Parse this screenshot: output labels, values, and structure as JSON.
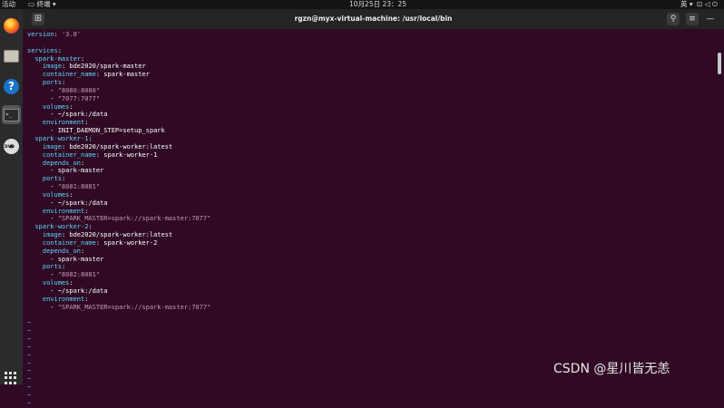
{
  "topbar": {
    "activities": "活动",
    "app": "终端",
    "clock": "10月25日  23：25",
    "lang": "英",
    "system": "▾"
  },
  "window": {
    "title": "rgzn@myx-virtual-machine: /usr/local/bin",
    "new_tab_icon": "new-tab-icon",
    "search_icon": "search-icon",
    "menu_icon": "hamburger-menu-icon",
    "minimize_glyph": "—"
  },
  "dock": {
    "items": [
      "firefox-icon",
      "files-icon",
      "help-icon",
      "terminal-icon",
      "dvd-icon",
      "show-apps-icon"
    ],
    "dvd_label": "DVD",
    "terminal_glyph": ">_"
  },
  "colors": {
    "terminal_bg": "#300a24",
    "key": "#5fd7ff",
    "string": "#c29bb7",
    "tilde": "#5fa8ff"
  },
  "editor": {
    "lines": [
      [
        {
          "t": "version",
          "c": "k"
        },
        {
          "t": ": ",
          "c": "w"
        },
        {
          "t": "'3.8'",
          "c": "s"
        }
      ],
      [],
      [
        {
          "t": "services",
          "c": "k"
        },
        {
          "t": ":",
          "c": "w"
        }
      ],
      [
        {
          "t": "  spark-master",
          "c": "k"
        },
        {
          "t": ":",
          "c": "w"
        }
      ],
      [
        {
          "t": "    image",
          "c": "k"
        },
        {
          "t": ": bde2020/spark-master",
          "c": "w"
        }
      ],
      [
        {
          "t": "    container_name",
          "c": "k"
        },
        {
          "t": ": spark-master",
          "c": "w"
        }
      ],
      [
        {
          "t": "    ports",
          "c": "k"
        },
        {
          "t": ":",
          "c": "w"
        }
      ],
      [
        {
          "t": "      - ",
          "c": "w"
        },
        {
          "t": "\"8080:8080\"",
          "c": "s"
        }
      ],
      [
        {
          "t": "      - ",
          "c": "w"
        },
        {
          "t": "\"7077:7077\"",
          "c": "s"
        }
      ],
      [
        {
          "t": "    volumes",
          "c": "k"
        },
        {
          "t": ":",
          "c": "w"
        }
      ],
      [
        {
          "t": "      - ~/spark:/data",
          "c": "w"
        }
      ],
      [
        {
          "t": "    environment",
          "c": "k"
        },
        {
          "t": ":",
          "c": "w"
        }
      ],
      [
        {
          "t": "      - INIT_DAEMON_STEP=setup_spark",
          "c": "w"
        }
      ],
      [
        {
          "t": "  spark-worker-1",
          "c": "k"
        },
        {
          "t": ":",
          "c": "w"
        }
      ],
      [
        {
          "t": "    image",
          "c": "k"
        },
        {
          "t": ": bde2020/spark-worker:latest",
          "c": "w"
        }
      ],
      [
        {
          "t": "    container_name",
          "c": "k"
        },
        {
          "t": ": spark-worker-1",
          "c": "w"
        }
      ],
      [
        {
          "t": "    depends_on",
          "c": "k"
        },
        {
          "t": ":",
          "c": "w"
        }
      ],
      [
        {
          "t": "      - spark-master",
          "c": "w"
        }
      ],
      [
        {
          "t": "    ports",
          "c": "k"
        },
        {
          "t": ":",
          "c": "w"
        }
      ],
      [
        {
          "t": "      - ",
          "c": "w"
        },
        {
          "t": "\"8081:8081\"",
          "c": "s"
        }
      ],
      [
        {
          "t": "    volumes",
          "c": "k"
        },
        {
          "t": ":",
          "c": "w"
        }
      ],
      [
        {
          "t": "      - ~/spark:/data",
          "c": "w"
        }
      ],
      [
        {
          "t": "    environment",
          "c": "k"
        },
        {
          "t": ":",
          "c": "w"
        }
      ],
      [
        {
          "t": "      - ",
          "c": "w"
        },
        {
          "t": "\"SPARK_MASTER=spark://spark-master:7077\"",
          "c": "s"
        }
      ],
      [
        {
          "t": "  spark-worker-2",
          "c": "k"
        },
        {
          "t": ":",
          "c": "w"
        }
      ],
      [
        {
          "t": "    image",
          "c": "k"
        },
        {
          "t": ": bde2020/spark-worker:latest",
          "c": "w"
        }
      ],
      [
        {
          "t": "    container_name",
          "c": "k"
        },
        {
          "t": ": spark-worker-2",
          "c": "w"
        }
      ],
      [
        {
          "t": "    depends_on",
          "c": "k"
        },
        {
          "t": ":",
          "c": "w"
        }
      ],
      [
        {
          "t": "      - spark-master",
          "c": "w"
        }
      ],
      [
        {
          "t": "    ports",
          "c": "k"
        },
        {
          "t": ":",
          "c": "w"
        }
      ],
      [
        {
          "t": "      - ",
          "c": "w"
        },
        {
          "t": "\"8082:8081\"",
          "c": "s"
        }
      ],
      [
        {
          "t": "    volumes",
          "c": "k"
        },
        {
          "t": ":",
          "c": "w"
        }
      ],
      [
        {
          "t": "      - ~/spark:/data",
          "c": "w"
        }
      ],
      [
        {
          "t": "    environment",
          "c": "k"
        },
        {
          "t": ":",
          "c": "w"
        }
      ],
      [
        {
          "t": "      - ",
          "c": "w"
        },
        {
          "t": "\"SPARK_MASTER=spark://spark-master:7077\"",
          "c": "s"
        }
      ],
      [],
      [
        {
          "t": "~",
          "c": "tilde"
        }
      ],
      [
        {
          "t": "~",
          "c": "tilde"
        }
      ],
      [
        {
          "t": "~",
          "c": "tilde"
        }
      ],
      [
        {
          "t": "~",
          "c": "tilde"
        }
      ],
      [
        {
          "t": "~",
          "c": "tilde"
        }
      ],
      [
        {
          "t": "~",
          "c": "tilde"
        }
      ],
      [
        {
          "t": "~",
          "c": "tilde"
        }
      ],
      [
        {
          "t": "~",
          "c": "tilde"
        }
      ],
      [
        {
          "t": "~",
          "c": "tilde"
        }
      ],
      [
        {
          "t": "~",
          "c": "tilde"
        }
      ],
      [
        {
          "t": "~",
          "c": "tilde"
        }
      ]
    ]
  },
  "watermark": "CSDN @星川皆无恙"
}
